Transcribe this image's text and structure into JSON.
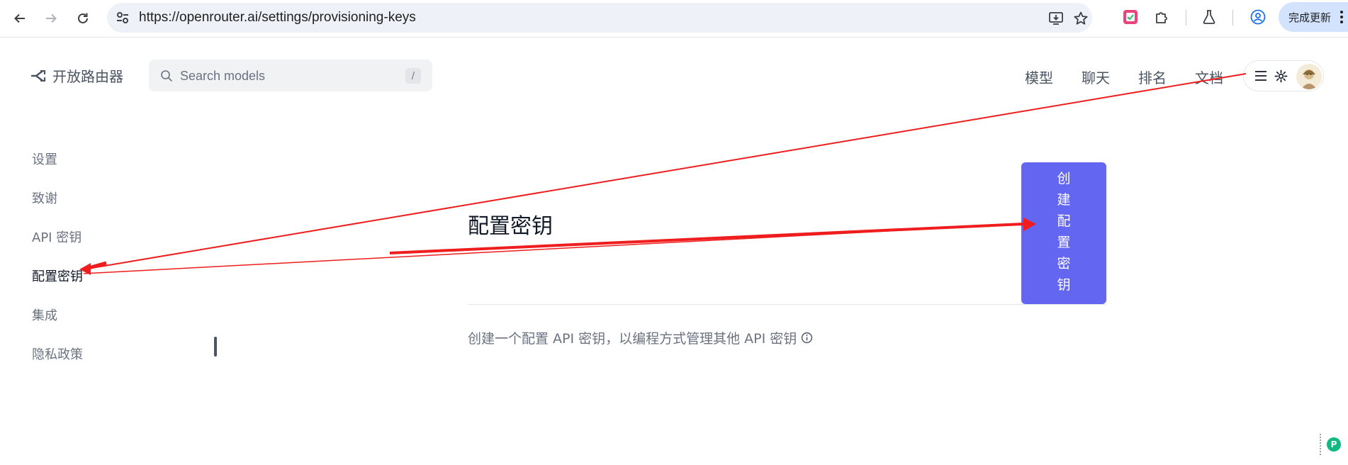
{
  "browser": {
    "url": "https://openrouter.ai/settings/provisioning-keys",
    "update_label": "完成更新"
  },
  "header": {
    "brand": "开放路由器",
    "search_placeholder": "Search models",
    "search_shortcut": "/",
    "nav": [
      "模型",
      "聊天",
      "排名",
      "文档"
    ]
  },
  "sidebar": {
    "items": [
      {
        "label": "设置"
      },
      {
        "label": "致谢"
      },
      {
        "label": "API 密钥"
      },
      {
        "label": "配置密钥"
      },
      {
        "label": "集成"
      },
      {
        "label": "隐私政策"
      }
    ],
    "active": "配置密钥"
  },
  "main": {
    "title": "配置密钥",
    "create_button": "创建配置密钥",
    "description": "创建一个配置 API 密钥，以编程方式管理其他 API 密钥"
  },
  "colors": {
    "accent": "#6366f1",
    "annotation_arrow": "#ef1d1d"
  },
  "icons": [
    "back-icon",
    "forward-icon",
    "reload-icon",
    "site-settings-icon",
    "install-app-icon",
    "bookmark-star-icon",
    "extension-icon",
    "puzzle-icon",
    "labs-flask-icon",
    "profile-icon",
    "menu-icon",
    "openrouter-logo-icon",
    "search-icon",
    "hamburger-icon",
    "gear-icon",
    "info-icon"
  ]
}
